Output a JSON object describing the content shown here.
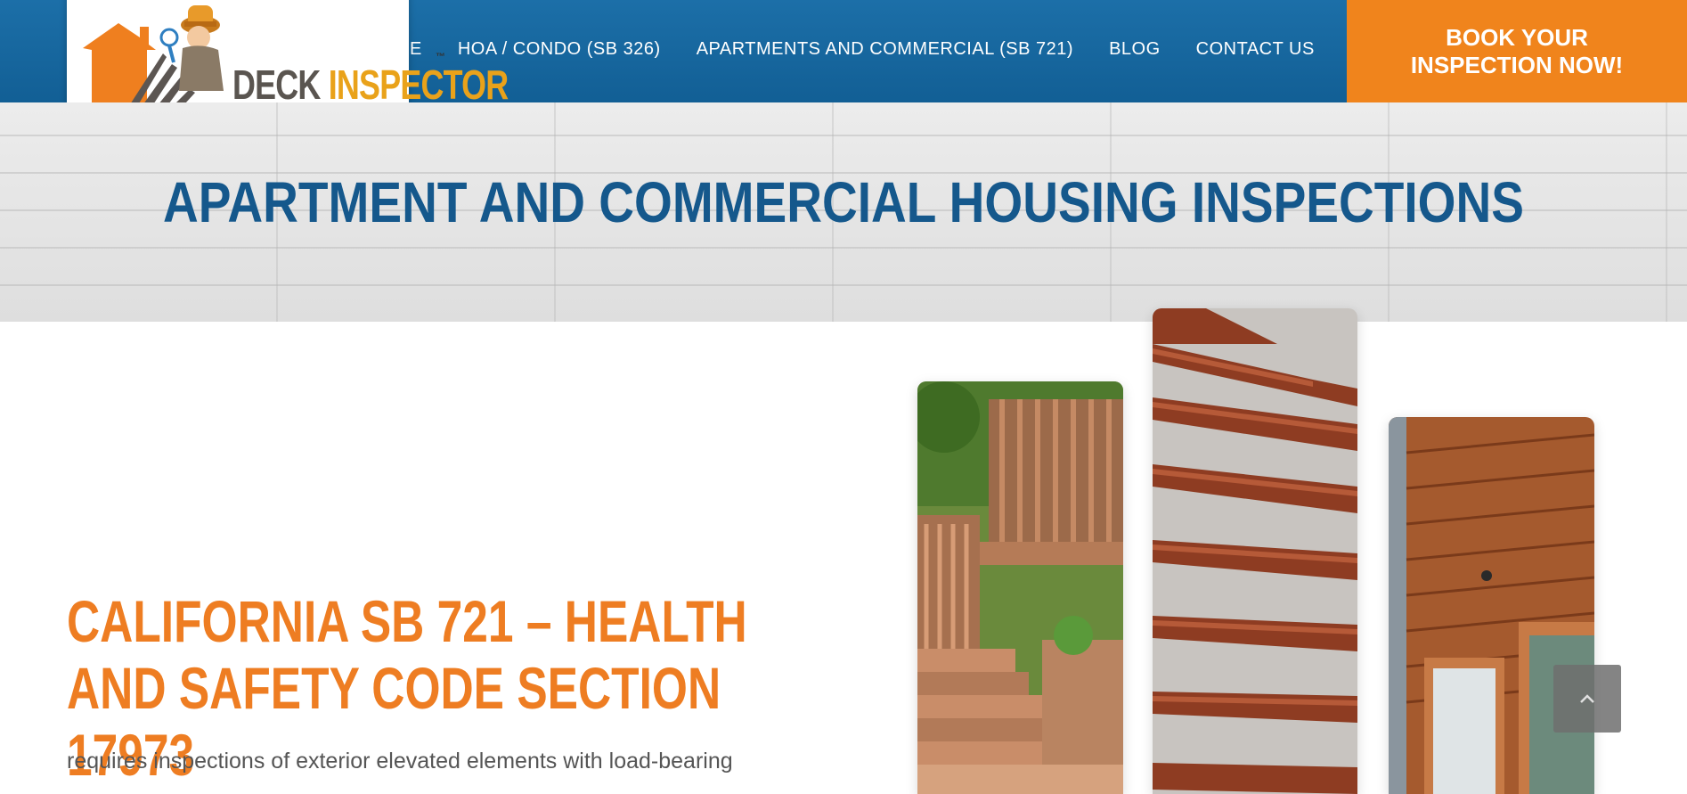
{
  "header": {
    "logo": {
      "word1": "DECK",
      "word2": "INSPECTOR",
      "tm": "™"
    },
    "nav": [
      {
        "label": "E"
      },
      {
        "label": "HOA / CONDO (SB 326)"
      },
      {
        "label": "APARTMENTS AND COMMERCIAL (SB 721)"
      },
      {
        "label": "BLOG"
      },
      {
        "label": "CONTACT US"
      }
    ],
    "book_button": {
      "line1": "BOOK YOUR",
      "line2": "INSPECTION NOW!"
    }
  },
  "hero": {
    "title": "Apartment and Commercial Housing Inspections"
  },
  "main": {
    "heading": "CALIFORNIA SB 721 –  HEALTH AND SAFETY CODE SECTION 17973",
    "body": "requires inspections of exterior elevated elements with load-bearing"
  },
  "scroll_top": {
    "icon": "chevron-up-icon"
  },
  "colors": {
    "nav_blue": "#1c6fa8",
    "accent_orange": "#f0841c",
    "heading_blue": "#15588c",
    "heading_orange": "#ee7d22"
  }
}
